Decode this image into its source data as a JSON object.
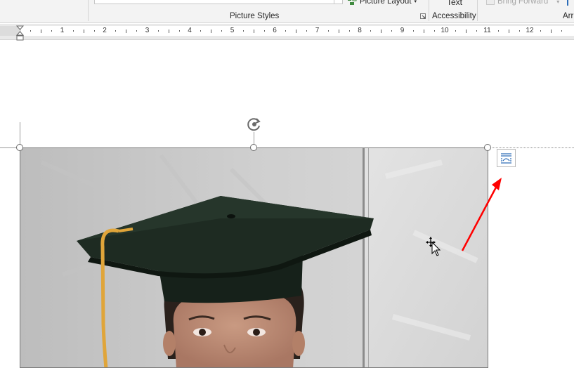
{
  "ribbon": {
    "picture_layout_label": "Picture Layout",
    "picture_styles_group": "Picture Styles",
    "alt_text_label": "Text",
    "accessibility_group": "Accessibility",
    "bring_forward_label": "Bring Forward",
    "arrange_group_partial": "Arr",
    "picture_layout_icon": "picture-layout-icon",
    "launcher_icon": "dialog-launcher-icon"
  },
  "ruler": {
    "numbers": [
      "1",
      "2",
      "3",
      "4",
      "5",
      "6",
      "7",
      "8",
      "9",
      "10",
      "11",
      "12"
    ]
  },
  "document": {
    "layout_options_icon": "layout-options-icon",
    "rotate_icon": "rotate-handle-icon",
    "cursor_icon": "move-cursor-icon",
    "annotation_icon": "red-arrow-annotation",
    "colors": {
      "annotation_red": "#ff0000",
      "cap_green": "#1f2e22",
      "tassel_gold": "#e0a53a",
      "wall_gray": "#d4d4d4"
    }
  }
}
